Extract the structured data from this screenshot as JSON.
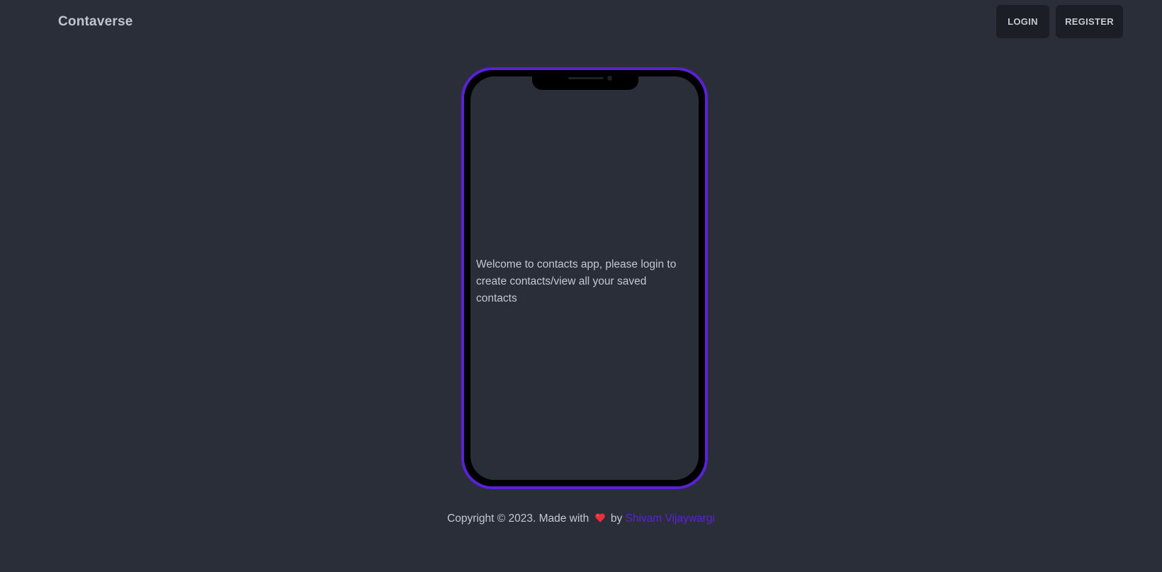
{
  "navbar": {
    "brand": "Contaverse",
    "login_label": "LOGIN",
    "register_label": "REGISTER"
  },
  "phone": {
    "welcome_text": "Welcome to contacts app, please login to create contacts/view all your saved contacts"
  },
  "footer": {
    "prefix": "Copyright © 2023. Made with",
    "by": "by",
    "author": "Shivam Vijaywargi",
    "heart_icon": "heart-icon"
  },
  "colors": {
    "background": "#2a2e38",
    "accent": "#5b21d8",
    "button_bg": "#1b1e25",
    "heart": "#e8303a"
  }
}
